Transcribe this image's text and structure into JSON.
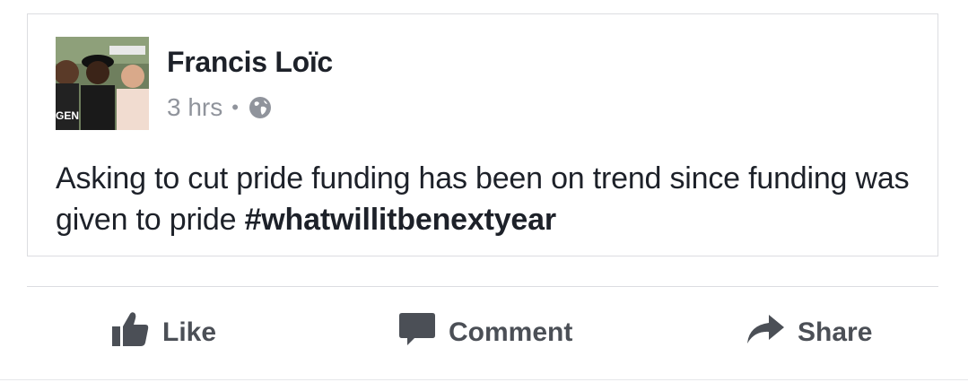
{
  "post": {
    "author": "Francis Loïc",
    "timestamp": "3 hrs",
    "separator": "•",
    "privacy_icon": "globe-icon",
    "text": "Asking to cut pride funding has been on trend since funding was given to pride ",
    "hashtag": "#whatwillitbenextyear"
  },
  "actions": {
    "like_label": "Like",
    "comment_label": "Comment",
    "share_label": "Share"
  },
  "colors": {
    "name": "#1d2129",
    "meta": "#90949c",
    "action": "#4b4f56",
    "border": "#dcdde1"
  }
}
